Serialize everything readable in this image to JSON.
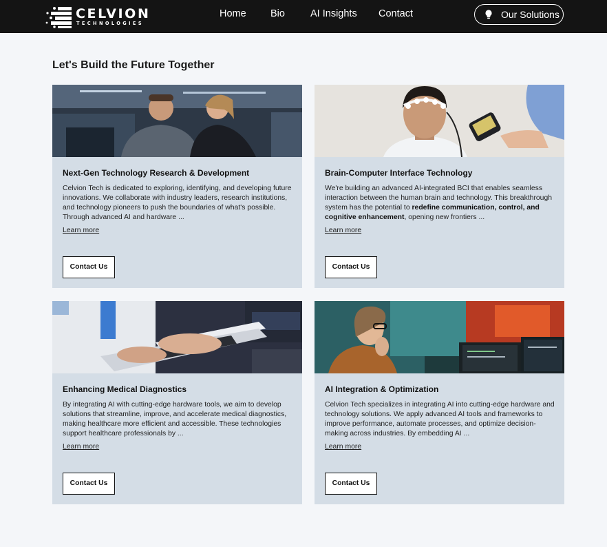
{
  "header": {
    "logo": {
      "word": "CELVION",
      "sub": "TECHNOLOGIES"
    },
    "nav": [
      "Home",
      "Bio",
      "AI Insights",
      "Contact"
    ],
    "solutions_button": {
      "icon": "lightbulb-icon",
      "label": "Our Solutions"
    }
  },
  "section_title": "Let's Build the Future Together",
  "cards": [
    {
      "image": "researchers-at-computer-photo",
      "title": "Next-Gen Technology Research & Development",
      "desc": "Celvion Tech is dedicated to exploring, identifying, and developing future innovations. We collaborate with industry leaders, research institutions, and technology pioneers to push the boundaries of what's possible. Through advanced AI and hardware ...",
      "link": "Learn more",
      "button": "Contact Us"
    },
    {
      "image": "bci-headset-photo",
      "title": "Brain-Computer Interface Technology",
      "desc_parts": [
        "We're building an advanced AI-integrated BCI that enables seamless interaction between the human brain and technology. This breakthrough system has the potential to ",
        "redefine communication, control, and cognitive enhancement",
        ", opening new frontiers ..."
      ],
      "link": "Learn more",
      "button": "Contact Us"
    },
    {
      "image": "doctor-typing-laptop-photo",
      "title": "Enhancing Medical Diagnostics",
      "desc": "By integrating AI with cutting-edge hardware tools, we aim to develop solutions that streamline, improve, and accelerate medical diagnostics, making healthcare more efficient and accessible. These technologies support healthcare professionals by ...",
      "link": "Learn more",
      "button": "Contact Us"
    },
    {
      "image": "engineer-at-monitors-photo",
      "title": "AI Integration & Optimization",
      "desc": "Celvion Tech specializes in integrating AI into cutting-edge hardware and technology solutions. We apply advanced AI tools and frameworks to improve performance, automate processes, and optimize decision-making across industries. By embedding AI ...",
      "link": "Learn more",
      "button": "Contact Us"
    }
  ],
  "colors": {
    "header_bg": "#141414",
    "page_bg": "#f4f6f9",
    "card_bg": "#d4dde6",
    "text": "#111111"
  }
}
